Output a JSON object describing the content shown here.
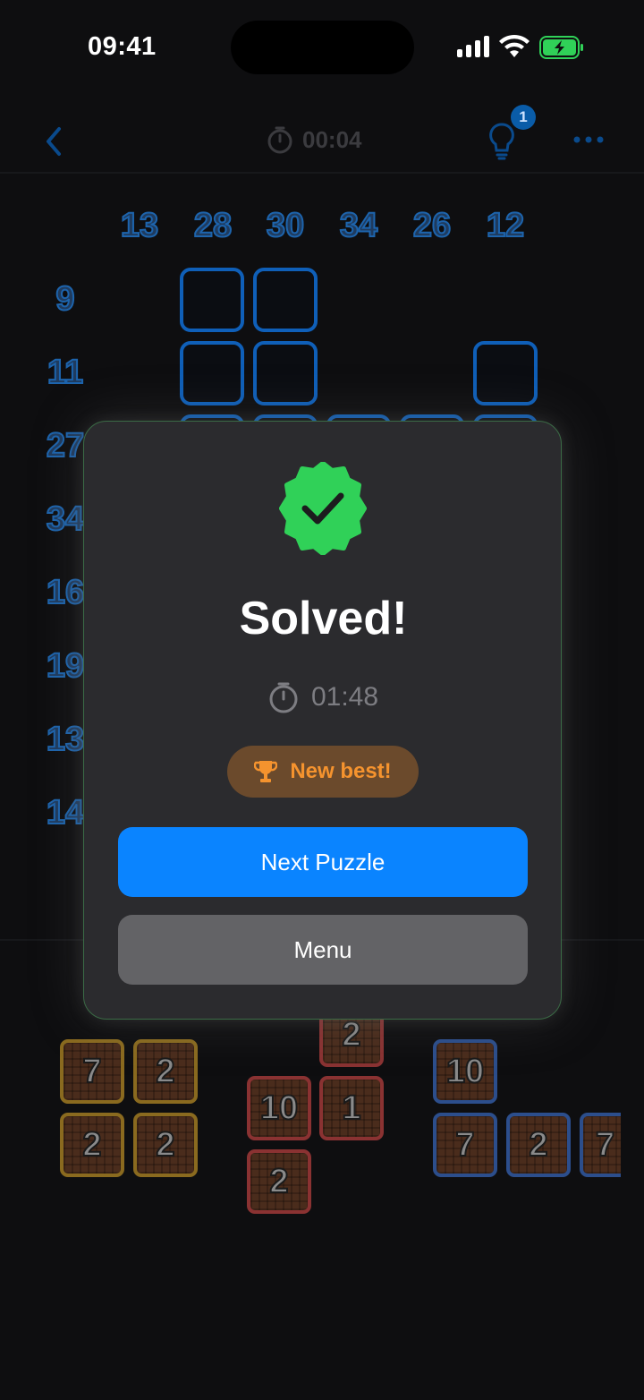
{
  "status_bar": {
    "time": "09:41"
  },
  "header": {
    "timer": "00:04",
    "hint_count": "1"
  },
  "column_clues": [
    "13",
    "28",
    "30",
    "34",
    "26",
    "12"
  ],
  "row_clues": [
    "9",
    "11",
    "27",
    "34",
    "16",
    "19",
    "13",
    "14"
  ],
  "tiles": [
    {
      "label": "2",
      "color": "red"
    },
    {
      "label": "10",
      "color": "blue"
    },
    {
      "label": "7",
      "color": "yellow"
    },
    {
      "label": "2",
      "color": "yellow"
    },
    {
      "label": "10",
      "color": "red"
    },
    {
      "label": "1",
      "color": "red"
    },
    {
      "label": "2",
      "color": "yellow"
    },
    {
      "label": "2",
      "color": "yellow"
    },
    {
      "label": "7",
      "color": "blue"
    },
    {
      "label": "2",
      "color": "blue"
    },
    {
      "label": "7",
      "color": "blue"
    },
    {
      "label": "2",
      "color": "red"
    }
  ],
  "modal": {
    "title": "Solved!",
    "time": "01:48",
    "badge": "New best!",
    "next_button": "Next Puzzle",
    "menu_button": "Menu"
  },
  "colors": {
    "accent": "#0a84ff",
    "success": "#30d158",
    "trophy": "#f5932e",
    "grid_cell": "#0f5fb8"
  },
  "icons": [
    "back-chevron-icon",
    "stopwatch-icon",
    "lightbulb-icon",
    "more-icon",
    "verified-check-icon",
    "trophy-icon"
  ]
}
